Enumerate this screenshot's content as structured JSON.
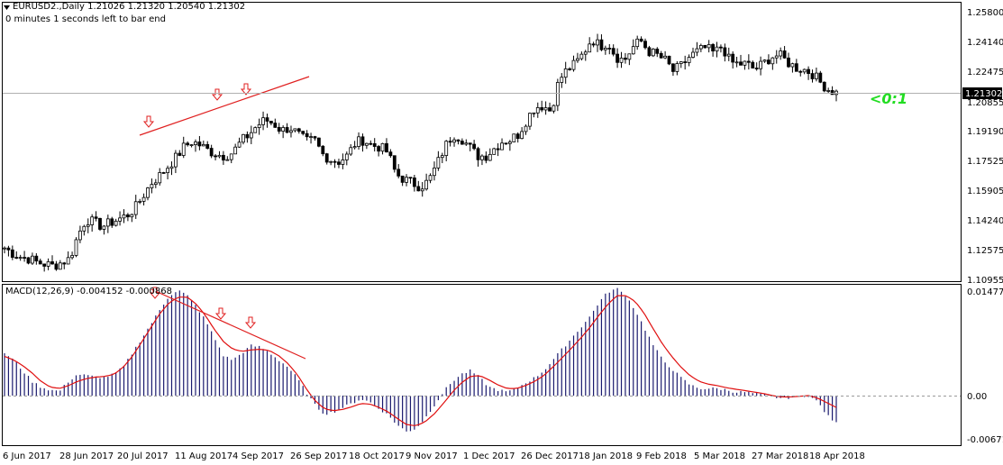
{
  "header": {
    "symbol_line": "EURUSD2.,Daily  1.21026 1.21320 1.20540 1.21302",
    "timer_line": "0 minutes 1 seconds left to bar end"
  },
  "price_panel": {
    "y_ticks": [
      "1.25800",
      "1.24140",
      "1.22475",
      "1.20855",
      "1.19190",
      "1.17525",
      "1.15905",
      "1.14240",
      "1.12575",
      "1.10955"
    ],
    "current_price": "1.21302",
    "counter_text": "<0:1",
    "colors": {
      "trendline": "#e02020",
      "arrow": "#e02020",
      "candles": "#000000",
      "price_box": "#000000",
      "counter": "#22dd22"
    }
  },
  "macd_panel": {
    "label": "MACD(12,26,9) -0.004152 -0.000868",
    "y_ticks": [
      "0.014776",
      "0.00",
      "-0.006714"
    ],
    "colors": {
      "histogram": "#1a1a6e",
      "signal": "#e01010"
    }
  },
  "x_axis": {
    "labels": [
      "6 Jun 2017",
      "28 Jun 2017",
      "20 Jul 2017",
      "11 Aug 2017",
      "4 Sep 2017",
      "26 Sep 2017",
      "18 Oct 2017",
      "9 Nov 2017",
      "1 Dec 2017",
      "26 Dec 2017",
      "18 Jan 2018",
      "9 Feb 2018",
      "5 Mar 2018",
      "27 Mar 2018",
      "18 Apr 2018"
    ]
  },
  "chart_data": [
    {
      "type": "candlestick",
      "title": "EURUSD2.,Daily",
      "ohlc_last": {
        "open": 1.21026,
        "high": 1.2132,
        "low": 1.2054,
        "close": 1.21302
      },
      "x_range": [
        "6 Jun 2017",
        "20 Apr 2018"
      ],
      "ylim": [
        1.10955,
        1.258
      ],
      "closes_approx": [
        1.127,
        1.124,
        1.122,
        1.121,
        1.119,
        1.118,
        1.117,
        1.119,
        1.121,
        1.134,
        1.143,
        1.141,
        1.139,
        1.141,
        1.143,
        1.145,
        1.149,
        1.156,
        1.163,
        1.167,
        1.172,
        1.177,
        1.183,
        1.186,
        1.184,
        1.181,
        1.179,
        1.178,
        1.18,
        1.186,
        1.19,
        1.195,
        1.198,
        1.196,
        1.192,
        1.194,
        1.19,
        1.186,
        1.187,
        1.179,
        1.176,
        1.175,
        1.178,
        1.185,
        1.187,
        1.184,
        1.183,
        1.18,
        1.168,
        1.165,
        1.163,
        1.161,
        1.164,
        1.173,
        1.183,
        1.19,
        1.188,
        1.183,
        1.178,
        1.178,
        1.182,
        1.186,
        1.187,
        1.19,
        1.198,
        1.205,
        1.206,
        1.203,
        1.22,
        1.226,
        1.229,
        1.235,
        1.243,
        1.239,
        1.241,
        1.233,
        1.231,
        1.238,
        1.242,
        1.236,
        1.234,
        1.231,
        1.225,
        1.228,
        1.233,
        1.236,
        1.238,
        1.235,
        1.239,
        1.23,
        1.229,
        1.229,
        1.226,
        1.229,
        1.233,
        1.234,
        1.23,
        1.227,
        1.226,
        1.224,
        1.219,
        1.215,
        1.213
      ],
      "annotations": [
        "trendline through three highs (Jul-Sep 2017)",
        "three down arrows marking highs"
      ]
    },
    {
      "type": "bar",
      "title": "MACD(12,26,9) -0.004152 -0.000868",
      "series": [
        {
          "name": "MACD",
          "values": [
            0.006,
            0.005,
            0.0035,
            0.002,
            0.0012,
            0.0008,
            0.0006,
            0.002,
            0.003,
            0.0028,
            0.0026,
            0.0026,
            0.003,
            0.004,
            0.006,
            0.008,
            0.01,
            0.012,
            0.014,
            0.0148,
            0.014,
            0.0125,
            0.0105,
            0.008,
            0.0055,
            0.005,
            0.006,
            0.007,
            0.0068,
            0.006,
            0.005,
            0.004,
            0.0025,
            0.0005,
            -0.0015,
            -0.0028,
            -0.0025,
            -0.0018,
            -0.0012,
            -0.0005,
            -0.001,
            -0.002,
            -0.003,
            -0.0045,
            -0.0055,
            -0.005,
            -0.0035,
            -0.0015,
            0.0005,
            0.002,
            0.003,
            0.0035,
            0.0025,
            0.0012,
            0.0008,
            0.0005,
            0.001,
            0.0018,
            0.0025,
            0.0035,
            0.005,
            0.0065,
            0.008,
            0.0095,
            0.011,
            0.013,
            0.0145,
            0.015,
            0.014,
            0.012,
            0.0095,
            0.007,
            0.005,
            0.0038,
            0.0025,
            0.0015,
            0.001,
            0.001,
            0.001,
            0.0008,
            0.0005,
            0.0005,
            0.0003,
            0.0001,
            -0.0002,
            -0.0004,
            -0.0003,
            -0.0001,
            0.0,
            -0.001,
            -0.003,
            -0.0042
          ]
        },
        {
          "name": "Signal",
          "values": [
            0.0055,
            0.005,
            0.0042,
            0.0032,
            0.002,
            0.0012,
            0.001,
            0.0014,
            0.002,
            0.0024,
            0.0026,
            0.0027,
            0.003,
            0.004,
            0.0055,
            0.0075,
            0.0095,
            0.0115,
            0.013,
            0.0138,
            0.0138,
            0.0128,
            0.0112,
            0.0092,
            0.0075,
            0.0065,
            0.0062,
            0.0064,
            0.0065,
            0.0063,
            0.0056,
            0.0045,
            0.003,
            0.001,
            -0.0008,
            -0.002,
            -0.0023,
            -0.0021,
            -0.0017,
            -0.0012,
            -0.0013,
            -0.0018,
            -0.0025,
            -0.0035,
            -0.0044,
            -0.0046,
            -0.004,
            -0.0028,
            -0.0012,
            0.0005,
            0.0018,
            0.0027,
            0.0028,
            0.0022,
            0.0015,
            0.001,
            0.001,
            0.0014,
            0.002,
            0.0028,
            0.004,
            0.0053,
            0.0066,
            0.008,
            0.0095,
            0.0112,
            0.0128,
            0.014,
            0.014,
            0.0132,
            0.0115,
            0.0093,
            0.0072,
            0.0055,
            0.004,
            0.0028,
            0.002,
            0.0016,
            0.0014,
            0.0011,
            0.0009,
            0.0007,
            0.0005,
            0.0003,
            0.0,
            -0.0002,
            -0.0002,
            -0.0001,
            0.0,
            -0.0004,
            -0.0011,
            -0.0018
          ]
        }
      ],
      "ylim": [
        -0.006714,
        0.014776
      ]
    }
  ]
}
